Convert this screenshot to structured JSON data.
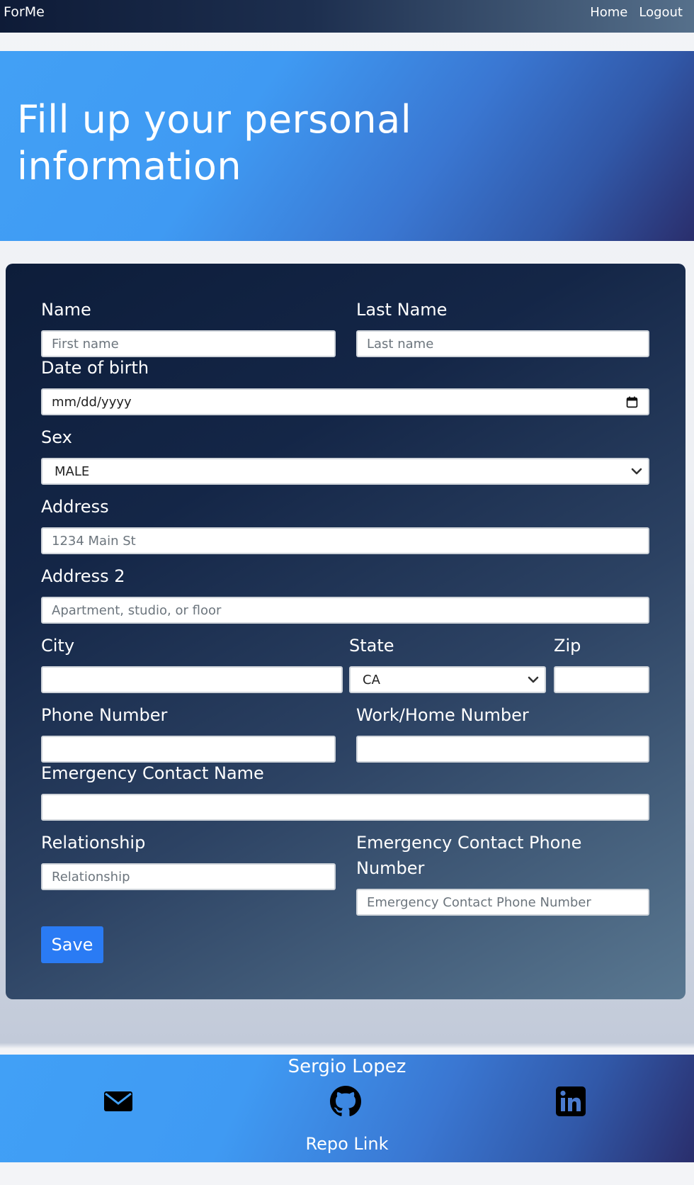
{
  "nav": {
    "brand": "ForMe",
    "links": [
      "Home",
      "Logout"
    ]
  },
  "hero": {
    "title": "Fill up your personal information"
  },
  "form": {
    "name_label": "Name",
    "name_placeholder": "First name",
    "last_name_label": "Last Name",
    "last_name_placeholder": "Last name",
    "dob_label": "Date of birth",
    "dob_placeholder": "mm/dd/yyyy",
    "sex_label": "Sex",
    "sex_value": "MALE",
    "address_label": "Address",
    "address_placeholder": "1234 Main St",
    "address2_label": "Address 2",
    "address2_placeholder": "Apartment, studio, or floor",
    "city_label": "City",
    "city_value": "",
    "state_label": "State",
    "state_value": "CA",
    "zip_label": "Zip",
    "zip_value": "",
    "phone_label": "Phone Number",
    "phone_value": "",
    "work_label": "Work/Home Number",
    "work_value": "",
    "emergency_name_label": "Emergency Contact Name",
    "emergency_name_value": "",
    "relationship_label": "Relationship",
    "relationship_placeholder": "Relationship",
    "emergency_phone_label_line1": "Emergency Contact Phone",
    "emergency_phone_label_line2": "Number",
    "emergency_phone_placeholder": "Emergency Contact Phone Number",
    "save_label": "Save"
  },
  "footer": {
    "author": "Sergio Lopez",
    "repo_link": "Repo Link",
    "icons": [
      "mail-icon",
      "github-icon",
      "linkedin-icon"
    ]
  },
  "colors": {
    "hero_start": "#42a0f5",
    "hero_end": "#2a2e6c",
    "save_button": "#2a7bf4",
    "card_start": "#0d1d3a",
    "card_end": "#5a7891"
  }
}
